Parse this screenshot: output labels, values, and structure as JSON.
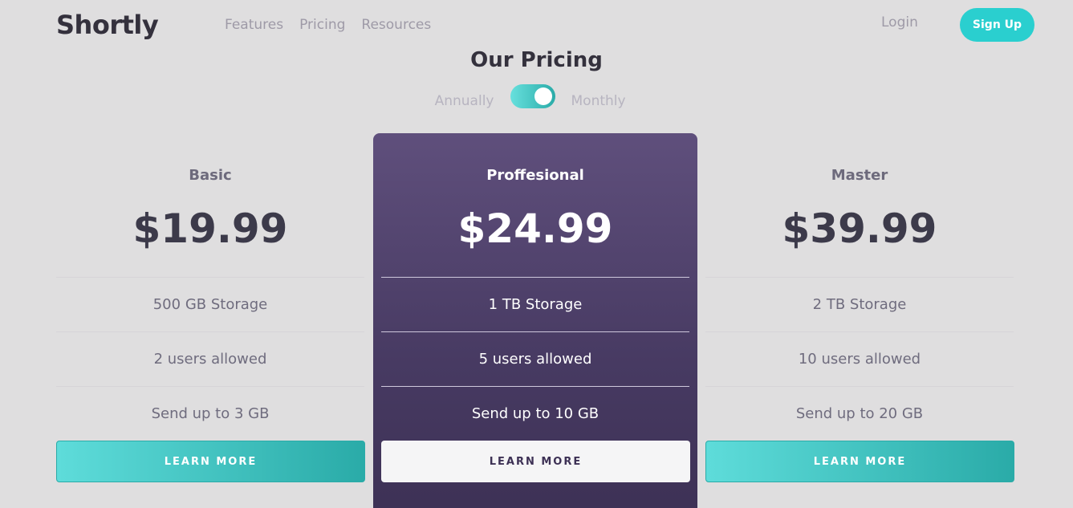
{
  "header": {
    "logo": "Shortly",
    "nav": [
      "Features",
      "Pricing",
      "Resources"
    ],
    "login": "Login",
    "signup": "Sign Up"
  },
  "pricing": {
    "title": "Our Pricing",
    "toggle": {
      "left_label": "Annually",
      "right_label": "Monthly",
      "state": "Monthly"
    }
  },
  "plans": [
    {
      "name": "Basic",
      "price": "$19.99",
      "features": [
        "500 GB Storage",
        "2 users allowed",
        "Send up to 3 GB"
      ],
      "cta": "LEARN MORE"
    },
    {
      "name": "Proffesional",
      "price": "$24.99",
      "features": [
        "1 TB Storage",
        "5 users allowed",
        "Send up to 10 GB"
      ],
      "cta": "LEARN MORE"
    },
    {
      "name": "Master",
      "price": "$39.99",
      "features": [
        "2 TB Storage",
        "10 users allowed",
        "Send up to 20 GB"
      ],
      "cta": "LEARN MORE"
    }
  ],
  "colors": {
    "accent": "#2acfcf",
    "accent_dark": "#2aaba8",
    "featured_card": "#4f426c",
    "background": "#dfdedf"
  }
}
